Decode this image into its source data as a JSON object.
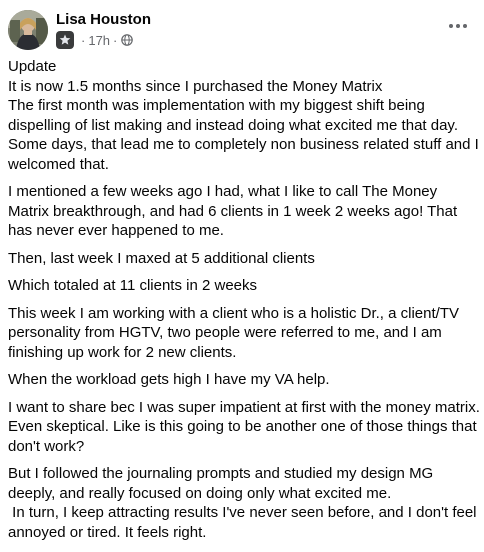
{
  "post": {
    "author": "Lisa Houston",
    "time": "17h",
    "separator": "·",
    "icons": {
      "badge": "group-badge-icon",
      "audience": "globe-icon",
      "menu": "more-options-icon"
    },
    "paragraphs": [
      "Update\nIt is now 1.5 months since I purchased the Money Matrix\nThe first month was implementation with my biggest shift being dispelling of list making and instead doing what excited me that day. Some days, that lead me to completely non business related stuff and I welcomed that.",
      "I mentioned a few weeks ago I had, what I like to call The Money Matrix breakthrough, and had 6 clients in 1 week 2 weeks ago! That has never ever happened to me.",
      "Then, last week I maxed at 5 additional clients",
      "Which totaled at 11 clients in 2 weeks",
      "This week I am working with a client who is a holistic Dr., a client/TV personality from HGTV, two people were referred to me, and I am finishing up work for 2 new clients.",
      "When the workload gets high I have my VA help.",
      "I want to share bec I was super impatient at first with the money matrix. Even skeptical. Like is this going to be another one of those things that don't work?",
      "But I followed the journaling prompts and studied my design MG deeply, and really focused on doing only what excited me.\n In turn, I keep attracting results I've never seen before, and I don't feel annoyed or tired. It feels right."
    ]
  }
}
